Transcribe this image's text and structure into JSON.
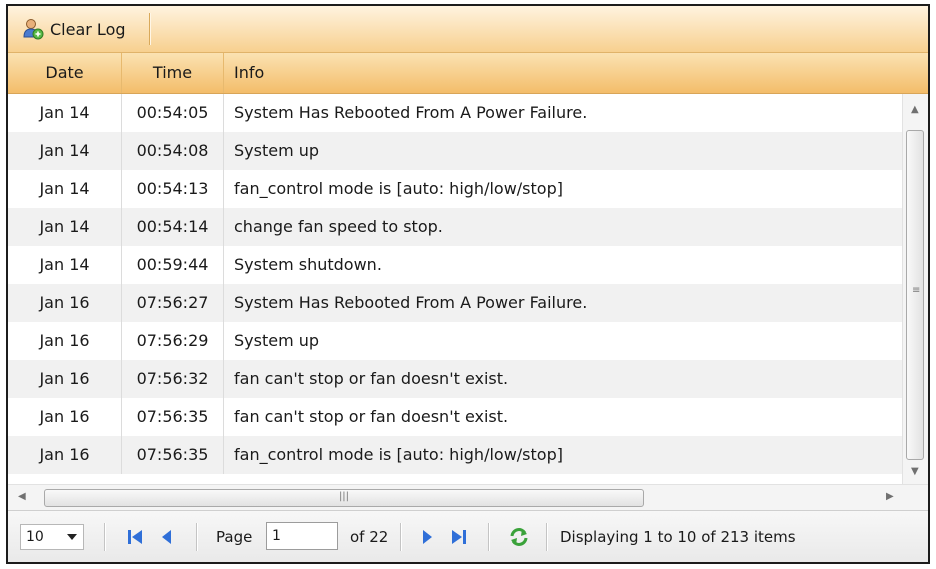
{
  "toolbar": {
    "clear_log_label": "Clear Log",
    "clear_log_icon": "user-clear-icon"
  },
  "columns": {
    "date": "Date",
    "time": "Time",
    "info": "Info"
  },
  "rows": [
    {
      "date": "Jan 14",
      "time": "00:54:05",
      "info": "System Has Rebooted From A Power Failure."
    },
    {
      "date": "Jan 14",
      "time": "00:54:08",
      "info": "System up"
    },
    {
      "date": "Jan 14",
      "time": "00:54:13",
      "info": "fan_control mode is [auto: high/low/stop]"
    },
    {
      "date": "Jan 14",
      "time": "00:54:14",
      "info": "change fan speed to stop."
    },
    {
      "date": "Jan 14",
      "time": "00:59:44",
      "info": "System shutdown."
    },
    {
      "date": "Jan 16",
      "time": "07:56:27",
      "info": "System Has Rebooted From A Power Failure."
    },
    {
      "date": "Jan 16",
      "time": "07:56:29",
      "info": "System up"
    },
    {
      "date": "Jan 16",
      "time": "07:56:32",
      "info": "fan can't stop or fan doesn't exist."
    },
    {
      "date": "Jan 16",
      "time": "07:56:35",
      "info": "fan can't stop or fan doesn't exist."
    },
    {
      "date": "Jan 16",
      "time": "07:56:35",
      "info": "fan_control mode is [auto: high/low/stop]"
    }
  ],
  "pager": {
    "page_size": "10",
    "page_label": "Page",
    "page_value": "1",
    "of_label": "of 22",
    "display_text": "Displaying 1 to 10 of 213 items"
  },
  "colors": {
    "toolbar_top": "#fff3df",
    "toolbar_bottom": "#f7d08f",
    "header": "#f3bd6a",
    "nav_blue": "#2f6fd8",
    "refresh_green": "#3aa23a"
  }
}
